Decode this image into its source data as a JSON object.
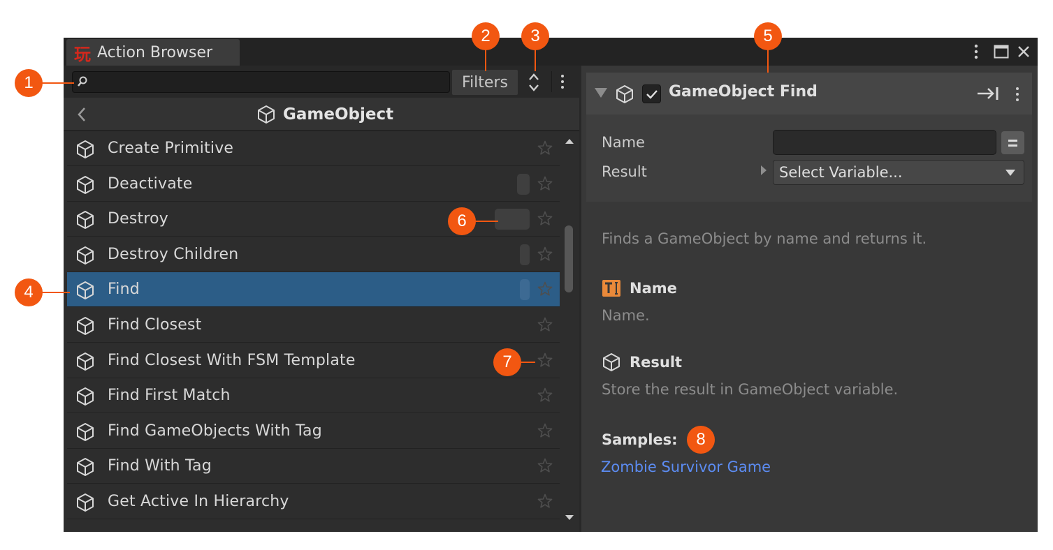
{
  "window": {
    "tab_title": "Action Browser",
    "logo_glyph": "玩",
    "logo_color": "#d4281c"
  },
  "toolbar": {
    "search_value": "",
    "filters_label": "Filters"
  },
  "nav": {
    "category": "GameObject"
  },
  "actions": [
    {
      "label": "Create Primitive",
      "usage": 0
    },
    {
      "label": "Deactivate",
      "usage": 0.36
    },
    {
      "label": "Destroy",
      "usage": 1.0
    },
    {
      "label": "Destroy Children",
      "usage": 0.28
    },
    {
      "label": "Find",
      "usage": 0.28,
      "selected": true
    },
    {
      "label": "Find Closest",
      "usage": 0
    },
    {
      "label": "Find Closest With FSM Template",
      "usage": 0
    },
    {
      "label": "Find First Match",
      "usage": 0
    },
    {
      "label": "Find GameObjects With Tag",
      "usage": 0
    },
    {
      "label": "Find With Tag",
      "usage": 0
    },
    {
      "label": "Get Active In Hierarchy",
      "usage": 0
    }
  ],
  "detail": {
    "title": "GameObject Find",
    "enabled": true,
    "fields": {
      "name_label": "Name",
      "name_value": "",
      "result_label": "Result",
      "result_value": "Select Variable..."
    },
    "description": "Finds a GameObject by name and returns it.",
    "params": [
      {
        "name": "Name",
        "description": "Name.",
        "icon": "string-param-icon"
      },
      {
        "name": "Result",
        "description": "Store the result in GameObject variable.",
        "icon": "cube-icon"
      }
    ],
    "samples_label": "Samples:",
    "samples": [
      "Zombie Survivor Game"
    ]
  },
  "callouts": [
    "1",
    "2",
    "3",
    "4",
    "5",
    "6",
    "7",
    "8"
  ],
  "colors": {
    "accent": "#f25711",
    "selection": "#2c5d87",
    "link": "#5c8cf2"
  }
}
